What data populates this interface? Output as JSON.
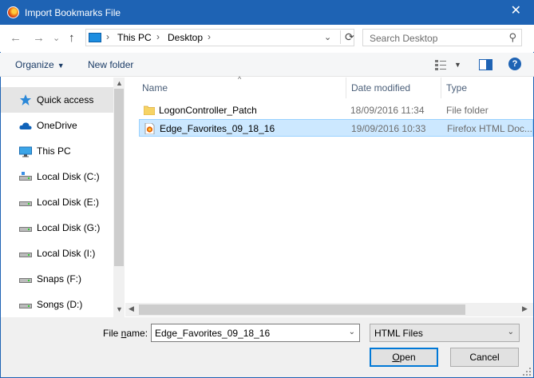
{
  "window": {
    "title": "Import Bookmarks File",
    "close_glyph": "✕"
  },
  "nav_buttons": {
    "back": "←",
    "forward": "→",
    "recent": "⌄",
    "up": "↑"
  },
  "address": {
    "crumbs": [
      "This PC",
      "Desktop"
    ],
    "separators": [
      "›",
      "›",
      "›"
    ],
    "dropdown": "⌄",
    "refresh": "⟳",
    "icon": "pc-icon"
  },
  "search": {
    "placeholder": "Search Desktop",
    "icon": "search-icon",
    "glyph": "⚲"
  },
  "commands": {
    "organize": "Organize",
    "new_folder": "New folder",
    "caret": "▼",
    "help": "?"
  },
  "nav_pane": {
    "items": [
      {
        "label": "Quick access",
        "icon": "star-icon",
        "selected": true
      },
      {
        "label": "OneDrive",
        "icon": "cloud-icon"
      },
      {
        "label": "This PC",
        "icon": "monitor-icon"
      },
      {
        "label": "Local Disk (C:)",
        "icon": "drive-icon"
      },
      {
        "label": "Local Disk (E:)",
        "icon": "drive-icon"
      },
      {
        "label": "Local Disk (G:)",
        "icon": "drive-icon"
      },
      {
        "label": "Local Disk (I:)",
        "icon": "drive-icon"
      },
      {
        "label": "Snaps (F:)",
        "icon": "drive-icon"
      },
      {
        "label": "Songs (D:)",
        "icon": "drive-icon"
      }
    ],
    "scroll_up": "▲",
    "scroll_down": "▼"
  },
  "file_list": {
    "columns": [
      "Name",
      "Date modified",
      "Type"
    ],
    "sort_caret": "^",
    "rows": [
      {
        "name": "LogonController_Patch",
        "date": "18/09/2016 11:34",
        "type": "File folder",
        "icon": "folder-icon",
        "selected": false
      },
      {
        "name": "Edge_Favorites_09_18_16",
        "date": "19/09/2016 10:33",
        "type": "Firefox HTML Doc...",
        "icon": "html-file-icon",
        "selected": true
      }
    ],
    "scroll_left": "◀",
    "scroll_right": "▶"
  },
  "footer": {
    "file_name_label_prefix": "File ",
    "file_name_label_hotkey": "n",
    "file_name_label_suffix": "ame:",
    "file_name_value": "Edge_Favorites_09_18_16",
    "file_type_value": "HTML Files",
    "dropdown": "⌄",
    "open_prefix": "",
    "open_hotkey": "O",
    "open_suffix": "pen",
    "cancel_label": "Cancel"
  },
  "colors": {
    "titlebar": "#1e63b4",
    "selection": "#cce8ff",
    "selection_border": "#99d1ff",
    "link": "#1a3b66",
    "folder": "#f6d365",
    "accent": "#0078d7"
  }
}
